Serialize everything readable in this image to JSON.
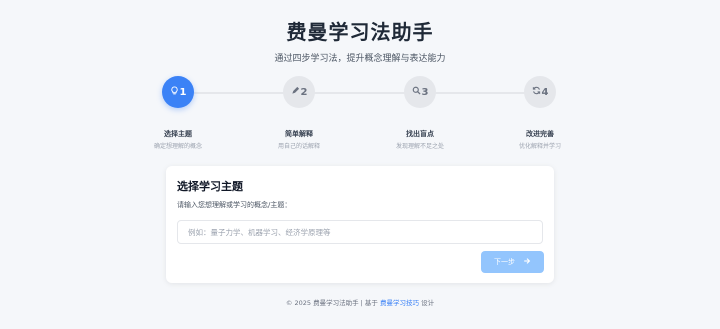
{
  "header": {
    "title": "费曼学习法助手",
    "subtitle": "通过四步学习法，提升概念理解与表达能力"
  },
  "steps": [
    {
      "number": "1",
      "label": "选择主题",
      "desc": "确定想理解的概念",
      "icon": "lightbulb-icon",
      "active": true
    },
    {
      "number": "2",
      "label": "简单解释",
      "desc": "用自己的话解释",
      "icon": "pencil-icon",
      "active": false
    },
    {
      "number": "3",
      "label": "找出盲点",
      "desc": "发现理解不足之处",
      "icon": "search-icon",
      "active": false
    },
    {
      "number": "4",
      "label": "改进完善",
      "desc": "优化解释并学习",
      "icon": "refresh-icon",
      "active": false
    }
  ],
  "card": {
    "title": "选择学习主题",
    "prompt": "请输入您想理解或学习的概念/主题：",
    "input_value": "",
    "input_placeholder": "例如：量子力学、机器学习、经济学原理等",
    "next_label": "下一步",
    "next_icon": "arrow-right-icon",
    "next_disabled": true
  },
  "footer": {
    "prefix": "© 2025 费曼学习法助手 | 基于",
    "link": "费曼学习技巧",
    "suffix": "设计"
  },
  "colors": {
    "accent": "#3b82f6",
    "accent_disabled": "#93c5fd",
    "inactive_step": "#e5e7eb",
    "background": "#f5f7fa"
  }
}
